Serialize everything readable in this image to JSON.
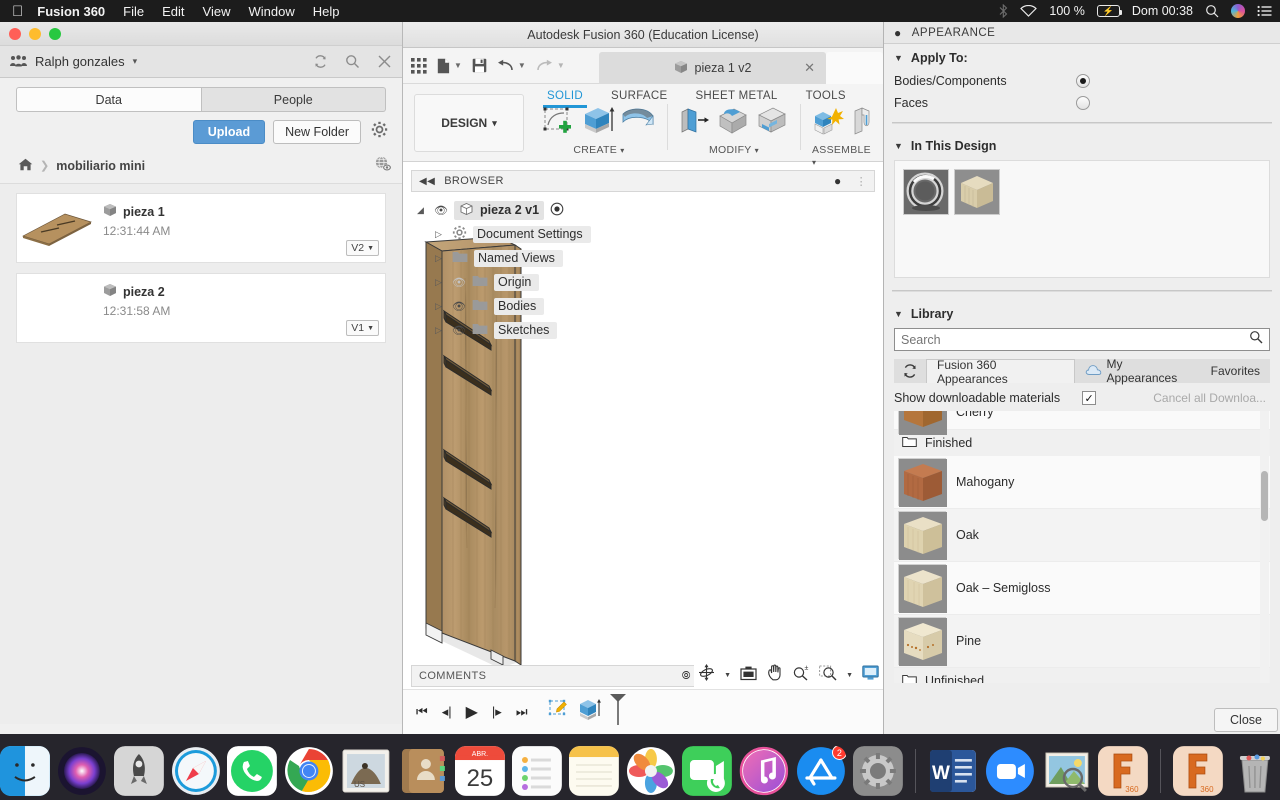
{
  "menubar": {
    "apple_icon": "apple-logo-icon",
    "app_name": "Fusion 360",
    "items": [
      "File",
      "Edit",
      "View",
      "Window",
      "Help"
    ],
    "status": {
      "bluetooth_icon": "bluetooth-icon",
      "wifi_icon": "wifi-icon",
      "battery_percent": "100 %",
      "battery_icon": "battery-charging-icon",
      "datetime": "Dom 00:38",
      "spotlight_icon": "search-icon",
      "siri_icon": "siri-icon",
      "controlcenter_icon": "list-menu-icon"
    }
  },
  "data_panel": {
    "window_controls": [
      "close",
      "minimize",
      "zoom"
    ],
    "hub": {
      "icon": "people-group-icon",
      "name": "Ralph gonzales",
      "caret": "▾"
    },
    "header_icons": [
      "refresh-icon",
      "search-icon",
      "close-icon"
    ],
    "tabs": [
      {
        "label": "Data",
        "active": true
      },
      {
        "label": "People",
        "active": false
      }
    ],
    "actions": {
      "upload": "Upload",
      "new_folder": "New Folder",
      "settings_icon": "gear-icon"
    },
    "breadcrumb": {
      "home_icon": "home-icon",
      "separator": "❯",
      "folder": "mobiliario mini",
      "visibility_icon": "globe-eye-icon"
    },
    "files": [
      {
        "name": "pieza 1",
        "time": "12:31:44 AM",
        "version": "V2",
        "has_thumbnail": true
      },
      {
        "name": "pieza 2",
        "time": "12:31:58 AM",
        "version": "V1",
        "has_thumbnail": false
      }
    ]
  },
  "fusion": {
    "title": "Autodesk Fusion 360 (Education License)",
    "quick_access": [
      "grid-apps-icon",
      "new-file-icon",
      "save-icon",
      "undo-icon",
      "redo-icon"
    ],
    "document_tab": {
      "icon": "cube-icon",
      "label": "pieza 1 v2",
      "close": "✕"
    },
    "workspace": {
      "label": "DESIGN",
      "caret": "▾"
    },
    "ribbon_tabs": [
      {
        "label": "SOLID",
        "active": true
      },
      {
        "label": "SURFACE",
        "active": false
      },
      {
        "label": "SHEET METAL",
        "active": false
      },
      {
        "label": "TOOLS",
        "active": false
      }
    ],
    "ribbon_groups": [
      {
        "label": "CREATE",
        "caret": "▾",
        "icons": [
          "new-sketch-icon",
          "extrude-icon",
          "revolve-icon"
        ]
      },
      {
        "label": "MODIFY",
        "caret": "▾",
        "icons": [
          "press-pull-icon",
          "fillet-icon",
          "shell-icon"
        ]
      },
      {
        "label": "ASSEMBLE",
        "caret": "▾",
        "icons": [
          "new-component-icon",
          "joint-icon"
        ]
      }
    ],
    "browser": {
      "header": "BROWSER",
      "collapse_icon": "collapse-left-icon",
      "minimize_icon": "minus-circle-icon",
      "root": {
        "label": "pieza 2 v1",
        "eye": "visible",
        "icon": "document-cube-icon",
        "activate_icon": "radio-target-icon"
      },
      "nodes": [
        {
          "label": "Document Settings",
          "icon": "gear-icon",
          "eye": "none"
        },
        {
          "label": "Named Views",
          "icon": "folder-icon",
          "eye": "none"
        },
        {
          "label": "Origin",
          "icon": "folder-icon",
          "eye": "hidden"
        },
        {
          "label": "Bodies",
          "icon": "folder-icon",
          "eye": "visible"
        },
        {
          "label": "Sketches",
          "icon": "folder-icon",
          "eye": "visible"
        }
      ]
    },
    "comments": {
      "label": "COMMENTS",
      "add_icon": "plus-circle-icon"
    },
    "nav_tools": [
      "orbit-icon",
      "view-cube-home-icon",
      "pan-icon",
      "zoom-icon",
      "zoom-window-icon",
      "display-settings-icon"
    ],
    "timeline": [
      "skip-start-icon",
      "step-back-icon",
      "play-icon",
      "step-forward-icon",
      "skip-end-icon",
      "sketch-feature-icon",
      "extrude-feature-icon",
      "timeline-marker-icon"
    ]
  },
  "appearance": {
    "title": "APPEARANCE",
    "minimize_icon": "minus-circle-icon",
    "apply_to": {
      "header": "Apply To:",
      "options": [
        {
          "label": "Bodies/Components",
          "selected": true
        },
        {
          "label": "Faces",
          "selected": false
        }
      ]
    },
    "in_this_design": {
      "header": "In This Design",
      "swatches": [
        "chrome-torus-swatch",
        "light-wood-cube-swatch"
      ]
    },
    "library": {
      "header": "Library",
      "search_placeholder": "Search",
      "search_icon": "search-icon",
      "refresh_icon": "refresh-icon",
      "tabs": [
        {
          "label": "Fusion 360 Appearances",
          "active": true
        },
        {
          "label": "My Appearances",
          "active": false,
          "icon": "cloud-icon"
        },
        {
          "label": "Favorites",
          "active": false
        }
      ],
      "downloadable": {
        "label": "Show downloadable materials",
        "checked": true,
        "checkmark": "✓"
      },
      "cancel_downloads": "Cancel all Downloa...",
      "items": [
        {
          "type": "material",
          "label": "Cherry",
          "swatch": "#b5763c",
          "partial": true
        },
        {
          "type": "group",
          "label": "Finished",
          "icon": "folder-icon"
        },
        {
          "type": "material",
          "label": "Mahogany",
          "swatch": "#b26a42"
        },
        {
          "type": "material",
          "label": "Oak",
          "swatch": "#ddd0ae"
        },
        {
          "type": "material",
          "label": "Oak – Semigloss",
          "swatch": "#dcd0b0"
        },
        {
          "type": "material",
          "label": "Pine",
          "swatch": "#e4dbc0"
        },
        {
          "type": "group",
          "label": "Unfinished",
          "icon": "folder-icon"
        }
      ]
    },
    "close_button": "Close"
  },
  "dock": {
    "items": [
      {
        "name": "finder",
        "running": true
      },
      {
        "name": "siri",
        "running": false
      },
      {
        "name": "launchpad",
        "running": false
      },
      {
        "name": "safari",
        "running": false
      },
      {
        "name": "whatsapp",
        "running": false
      },
      {
        "name": "chrome",
        "running": true
      },
      {
        "name": "mail",
        "running": false
      },
      {
        "name": "contacts",
        "running": false
      },
      {
        "name": "calendar",
        "running": false,
        "month": "ABR.",
        "day": "25"
      },
      {
        "name": "reminders",
        "running": false
      },
      {
        "name": "notes",
        "running": false
      },
      {
        "name": "photos",
        "running": false
      },
      {
        "name": "facetime",
        "running": false
      },
      {
        "name": "itunes",
        "running": false
      },
      {
        "name": "app-store",
        "running": false,
        "badge": "2"
      },
      {
        "name": "system-preferences",
        "running": true
      },
      {
        "name": "microsoft-word",
        "running": false
      },
      {
        "name": "zoom",
        "running": false
      },
      {
        "name": "preview",
        "running": false
      },
      {
        "name": "fusion-360",
        "running": true,
        "label": "360"
      },
      {
        "name": "fusion-360-second",
        "running": false,
        "label": "360"
      },
      {
        "name": "trash",
        "running": false
      }
    ]
  },
  "colors": {
    "accent_blue": "#2196d6",
    "upload_blue": "#5b9bd5",
    "wood_light": "#c2a272",
    "wood_dark": "#8a6a40",
    "panel_bg": "#eeeeee"
  }
}
